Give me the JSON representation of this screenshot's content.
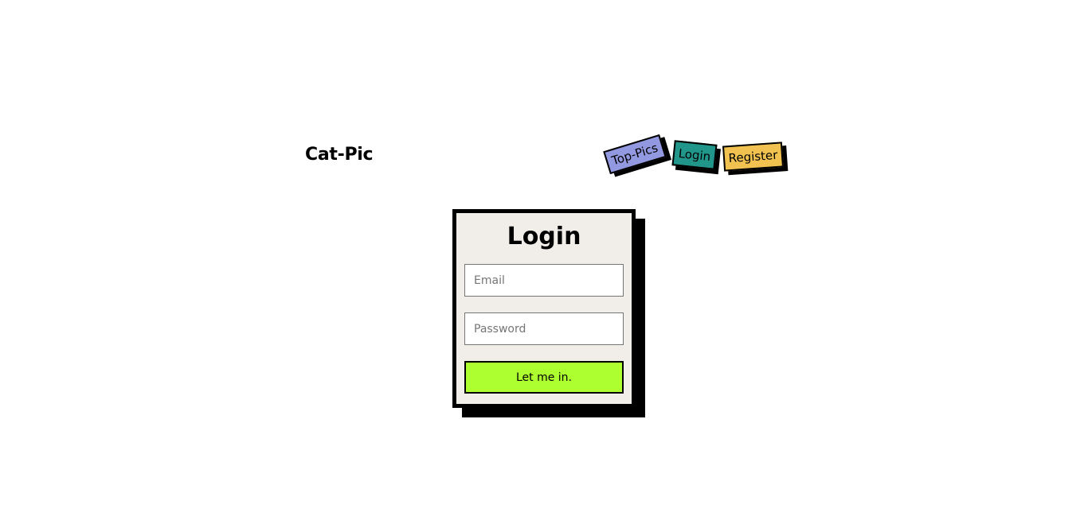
{
  "header": {
    "brand": "Cat-Pic",
    "nav": [
      {
        "label": "Top-Pics",
        "color": "#9399e0"
      },
      {
        "label": "Login",
        "color": "#21978b"
      },
      {
        "label": "Register",
        "color": "#f1c24f"
      }
    ]
  },
  "login_form": {
    "title": "Login",
    "background": "#f1ede9",
    "email_placeholder": "Email",
    "password_placeholder": "Password",
    "submit_label": "Let me in.",
    "submit_color": "#adff2f"
  }
}
